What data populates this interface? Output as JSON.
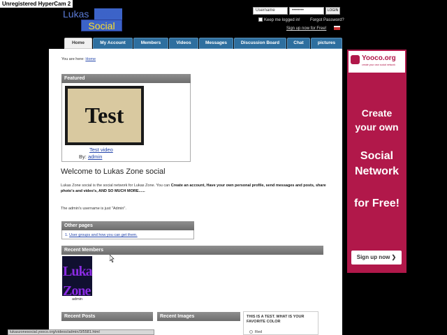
{
  "recorder": {
    "banner": "Unregistered HyperCam 2"
  },
  "logo": {
    "line1": "Lukas",
    "line2": "Zone",
    "line3": "Social"
  },
  "login": {
    "username_value": "Username",
    "password_value": "••••••••",
    "button_label": "LOGIN",
    "keep_label": "Keep me logged in!",
    "forgot_label": "Forgot Password?",
    "signup_label": "Sign up now for Free!"
  },
  "nav": {
    "tabs": [
      {
        "label": "Home",
        "active": true
      },
      {
        "label": "My Account"
      },
      {
        "label": "Members"
      },
      {
        "label": "Videos"
      },
      {
        "label": "Messages"
      },
      {
        "label": "Discussion Board"
      },
      {
        "label": "Chat"
      },
      {
        "label": "pictures"
      }
    ]
  },
  "breadcrumb": {
    "prefix": "You are here:",
    "link": "Home"
  },
  "featured": {
    "title": "Featured",
    "thumb_text": "Test",
    "video_title": "Test video",
    "by_label": "By:",
    "by_user": "admin"
  },
  "welcome": {
    "heading": "Welcome to Lukas Zone social",
    "intro_plain": "Lukas Zone social is the social network for Lukas Zone. You can ",
    "intro_bold": "Create an account, Have your own personal profile, send messages and posts, share photo's and video's, AND SO MUCH MORE......",
    "admin_note": "The admin's username is just \"Admin\"."
  },
  "other_pages": {
    "title": "Other pages",
    "item": "User groups and how you can get them."
  },
  "recent_members": {
    "title": "Recent Members",
    "avatar_text": "Lukas Zone",
    "member_name": "admin"
  },
  "recent_posts": {
    "title": "Recent Posts"
  },
  "recent_images": {
    "title": "Recent Images"
  },
  "poll": {
    "question": "THIS IS A TEST. WHAT IS YOUR FAVORITE COLOR",
    "option": "Red"
  },
  "statusbar": {
    "text": "lukaszonesocial.yooco.org/videos/admin/3/5581.html"
  },
  "ad": {
    "brand": "Yooco.org",
    "tagline": "create your own social network",
    "line1": "Create",
    "line2": "your own",
    "line3": "Social",
    "line4": "Network",
    "line5": "for Free!",
    "button": "Sign up now"
  },
  "colors": {
    "nav_blue": "#2e6f9f",
    "ad_magenta": "#b1184a",
    "box_header_gray": "#7a7a7a",
    "link_blue": "#2244aa"
  }
}
